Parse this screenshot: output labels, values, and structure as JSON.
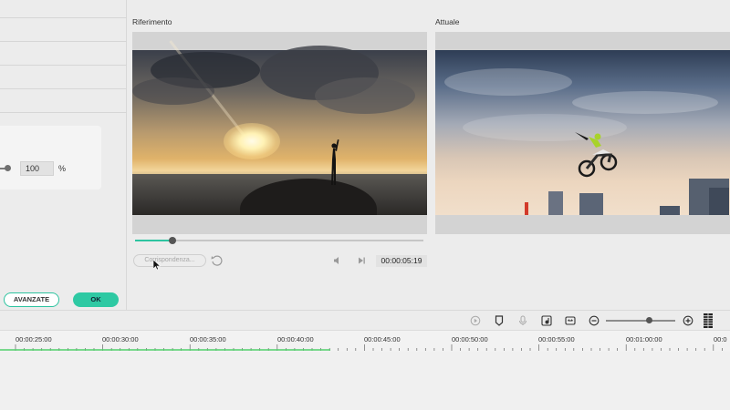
{
  "settings_panel": {
    "value": "100",
    "unit": "%",
    "advanced_label": "AVANZATE",
    "ok_label": "OK"
  },
  "reference": {
    "title": "Riferimento",
    "match_label": "Corrispondenza...",
    "timecode": "00:00:05:19",
    "progress": 0.13
  },
  "current": {
    "title": "Attuale"
  },
  "toolbar": {
    "icons": [
      "render-preview-icon",
      "marker-icon",
      "microphone-icon",
      "audio-mixer-icon",
      "split-icon",
      "zoom-out-icon",
      "zoom-in-icon",
      "grid-icon"
    ],
    "zoom_level": 0.62
  },
  "timeline": {
    "ruler_labels": [
      "00:00:25:00",
      "00:00:30:00",
      "00:00:35:00",
      "00:00:40:00",
      "00:00:45:00",
      "00:00:50:00",
      "00:00:55:00",
      "00:01:00:00",
      "00:0"
    ]
  },
  "colors": {
    "accent": "#2ec4a0"
  }
}
